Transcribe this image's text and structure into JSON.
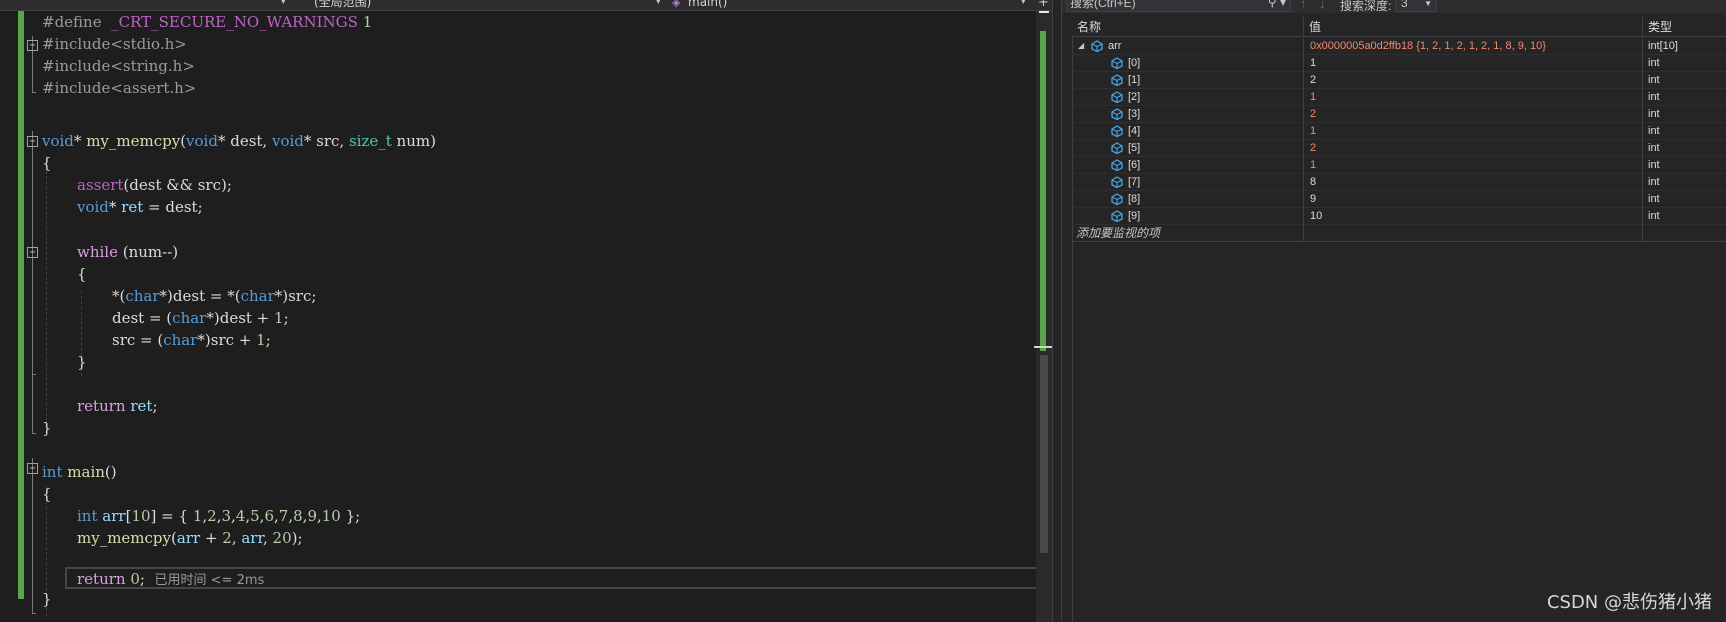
{
  "nav": {
    "scope": "(全局范围)",
    "function": "main()"
  },
  "code": {
    "l1_directive": "#define",
    "l1_macro": "_CRT_SECURE_NO_WARNINGS",
    "l1_value": "1",
    "l2": "#include<stdio.h>",
    "l3": "#include<string.h>",
    "l4": "#include<assert.h>",
    "perf_tip": "已用时间 <= 2ms"
  },
  "watch": {
    "search_placeholder": "搜索(Ctrl+E)",
    "depth_label": "搜索深度:",
    "depth_value": "3",
    "col_name": "名称",
    "col_value": "值",
    "col_type": "类型",
    "rows": [
      {
        "name": "arr",
        "value": "0x0000005a0d2ffb18 {1, 2, 1, 2, 1, 2, 1, 8, 9, 10}",
        "type": "int[10]",
        "changed": true,
        "expandable": true
      },
      {
        "name": "[0]",
        "value": "1",
        "type": "int",
        "changed": false
      },
      {
        "name": "[1]",
        "value": "2",
        "type": "int",
        "changed": false
      },
      {
        "name": "[2]",
        "value": "1",
        "type": "int",
        "changed": true
      },
      {
        "name": "[3]",
        "value": "2",
        "type": "int",
        "changed": true
      },
      {
        "name": "[4]",
        "value": "1",
        "type": "int",
        "changed": true
      },
      {
        "name": "[5]",
        "value": "2",
        "type": "int",
        "changed": true
      },
      {
        "name": "[6]",
        "value": "1",
        "type": "int",
        "changed": true
      },
      {
        "name": "[7]",
        "value": "8",
        "type": "int",
        "changed": false
      },
      {
        "name": "[8]",
        "value": "9",
        "type": "int",
        "changed": false
      },
      {
        "name": "[9]",
        "value": "10",
        "type": "int",
        "changed": false
      }
    ],
    "add_item": "添加要监视的项"
  },
  "watermark": "CSDN @悲伤猪小猪",
  "colors": {
    "keyword": "#569cd6",
    "control": "#d8a0df",
    "function": "#dcdcaa",
    "variable": "#9cdcfe",
    "type": "#4ec9b0",
    "changed_value": "#f48771",
    "change_bar": "#57a64a"
  }
}
